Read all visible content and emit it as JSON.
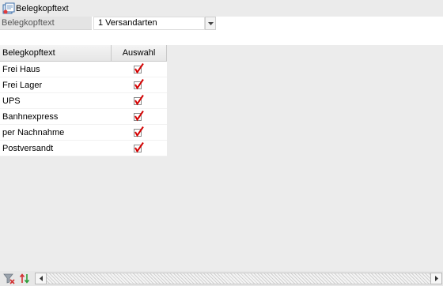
{
  "window": {
    "title": "Belegkopftext",
    "app_icon": "document-icon"
  },
  "filter": {
    "label": "Belegkopftext",
    "value": "1 Versandarten"
  },
  "grid": {
    "columns": [
      "Belegkopftext",
      "Auswahl"
    ],
    "rows": [
      {
        "name": "Frei Haus",
        "selected": true
      },
      {
        "name": "Frei Lager",
        "selected": true
      },
      {
        "name": "UPS",
        "selected": true
      },
      {
        "name": "Banhnexpress",
        "selected": true
      },
      {
        "name": "per Nachnahme",
        "selected": true
      },
      {
        "name": "Postversandt",
        "selected": true
      }
    ]
  },
  "bottom_toolbar": {
    "icons": [
      "filter-clear-icon",
      "sort-icon"
    ]
  },
  "colors": {
    "check": "#d40000",
    "grid_bg": "#ececec",
    "title_bg": "#ebebeb"
  }
}
